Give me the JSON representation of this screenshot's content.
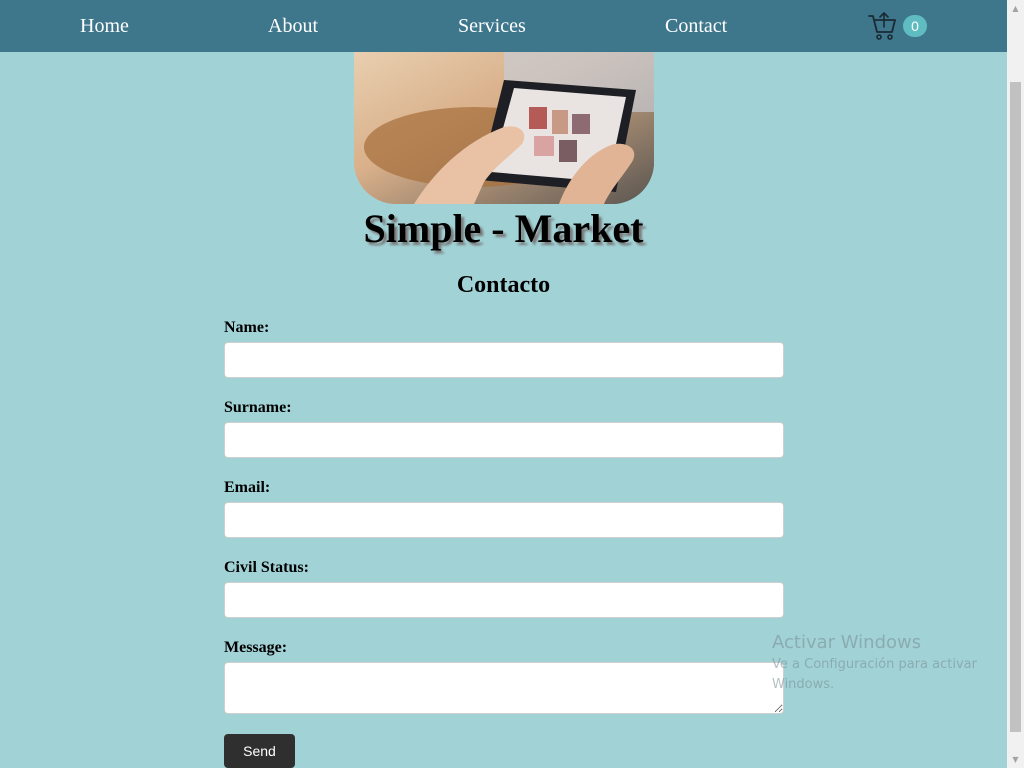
{
  "nav": {
    "home": "Home",
    "about": "About",
    "services": "Services",
    "contact": "Contact",
    "cart_count": "0",
    "cart_icon": "shopping-cart-icon"
  },
  "hero": {
    "image": "hands-using-tablet-photo"
  },
  "brand": "Simple - Market",
  "contact": {
    "title": "Contacto",
    "fields": {
      "name_label": "Name:",
      "surname_label": "Surname:",
      "email_label": "Email:",
      "civil_status_label": "Civil Status:",
      "message_label": "Message:"
    },
    "send_label": "Send"
  },
  "watermark": {
    "title": "Activar Windows",
    "subtitle": "Ve a Configuración para activar Windows."
  },
  "colors": {
    "background": "#a1d2d6",
    "navbar": "#3e768c",
    "badge": "#5fbdc1",
    "button": "#2f2f2f"
  }
}
